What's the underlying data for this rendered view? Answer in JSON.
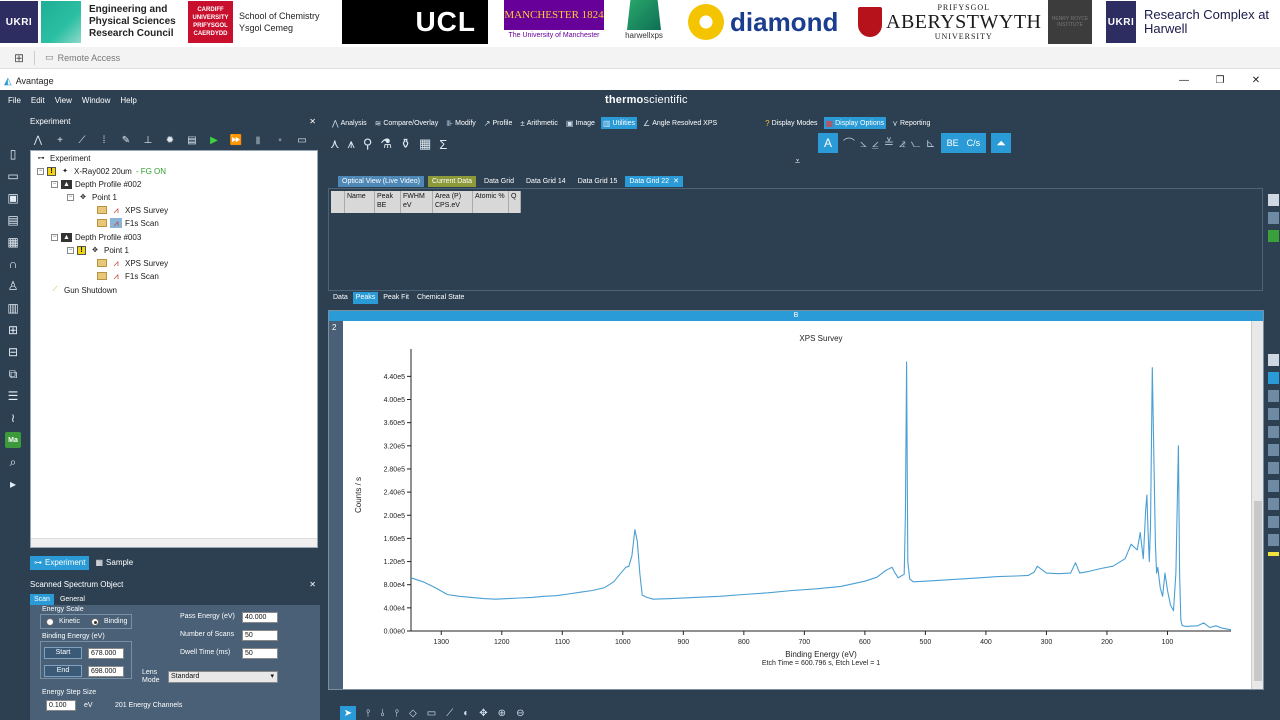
{
  "logos": {
    "ukri_1": "UKRI",
    "epsrc": "Engineering and Physical Sciences Research Council",
    "cardiff_mark": "CARDIFF UNIVERSITY PRIFYSGOL CAERDYDD",
    "cardiff_text": "School of Chemistry Ysgol Cemeg",
    "ucl": "UCL",
    "manchester": "MANCHESTER 1824",
    "manchester_sub": "The University of Manchester",
    "harwell": "harwellxps",
    "diamond": "diamond",
    "aber_top": "PRIFYSGOL",
    "aber_main": "ABERYSTWYTH",
    "aber_bottom": "UNIVERSITY",
    "hra": "HENRY ROYCE INSTITUTE",
    "rch": "Research Complex at Harwell"
  },
  "remote": {
    "label": "Remote Access"
  },
  "window": {
    "title": "Avantage",
    "minimize": "—",
    "maximize": "❐",
    "close": "✕"
  },
  "menu": [
    "File",
    "Edit",
    "View",
    "Window",
    "Help"
  ],
  "brand": {
    "bold": "thermo",
    "rest": "scientific"
  },
  "experiment": {
    "header": "Experiment",
    "close": "✕",
    "tree": {
      "root": "Experiment",
      "xray": "X-Ray002 20um",
      "fg": "- FG  ON",
      "dp2": "Depth Profile #002",
      "point1a": "Point 1",
      "xps1": "XPS Survey",
      "f1s1": "F1s Scan",
      "dp3": "Depth Profile #003",
      "point1b": "Point 1",
      "xps2": "XPS Survey",
      "f1s2": "F1s Scan",
      "gun": "Gun Shutdown"
    },
    "tabs": [
      "Experiment",
      "Sample"
    ]
  },
  "sso": {
    "header": "Scanned Spectrum Object",
    "close": "✕",
    "tabs": [
      "Scan",
      "General"
    ],
    "energy_scale": "Energy Scale",
    "kinetic": "Kinetic",
    "binding": "Binding",
    "binding_energy": "Binding Energy (eV)",
    "start_label": "Start",
    "start_value": "678.000",
    "end_label": "End",
    "end_value": "698.000",
    "pass_energy_label": "Pass Energy (eV)",
    "pass_energy_value": "40.000",
    "num_scans_label": "Number of Scans",
    "num_scans_value": "50",
    "dwell_label": "Dwell Time  (ms)",
    "dwell_value": "50",
    "lens_label": "Lens Mode",
    "lens_value": "Standard",
    "step_label": "Energy Step Size",
    "step_value": "0.100",
    "step_unit": "eV",
    "channels": "201 Energy Channels"
  },
  "ribbon": {
    "tabs": [
      "Analysis",
      "Compare/Overlay",
      "Modify",
      "Profile",
      "Arithmetic",
      "Image",
      "Utilities",
      "Angle Resolved XPS"
    ],
    "right_tabs": [
      "Display Modes",
      "Display Options",
      "Reporting"
    ],
    "pill_be": "BE",
    "pill_cs": "C/s"
  },
  "doc_tabs": [
    "Optical View (Live Video)",
    "Current Data",
    "Data Grid",
    "Data Grid 14",
    "Data Grid 15",
    "Data Grid 22"
  ],
  "grid": {
    "headers": [
      "",
      "Name",
      "Peak BE",
      "FWHM eV",
      "Area (P) CPS.eV",
      "Atomic %",
      "Q"
    ],
    "tabs": [
      "Data",
      "Peaks",
      "Peak Fit",
      "Chemical State"
    ]
  },
  "chart_panel": {
    "title": "B",
    "index": "2"
  },
  "chart_data": {
    "type": "line",
    "title": "XPS Survey",
    "xlabel": "Binding Energy (eV)",
    "ylabel": "Counts / s",
    "footer": "Etch Time = 600.796 s, Etch Level = 1",
    "xlim": [
      1350,
      -5
    ],
    "ylim": [
      0,
      470000
    ],
    "x_ticks": [
      1300,
      1200,
      1100,
      1000,
      900,
      800,
      700,
      600,
      500,
      400,
      300,
      200,
      100
    ],
    "y_ticks": [
      0,
      40000,
      80000,
      120000,
      160000,
      200000,
      240000,
      280000,
      320000,
      360000,
      400000,
      440000
    ],
    "y_tick_labels": [
      "0.00e0",
      "4.00e4",
      "8.00e4",
      "1.20e5",
      "1.60e5",
      "2.00e5",
      "2.40e5",
      "2.80e5",
      "3.20e5",
      "3.60e5",
      "4.00e5",
      "4.40e5"
    ],
    "grid": false,
    "series": [
      {
        "color": "#4a9fd4",
        "x": [
          1350,
          1330,
          1310,
          1290,
          1270,
          1250,
          1230,
          1210,
          1190,
          1170,
          1150,
          1130,
          1110,
          1090,
          1070,
          1050,
          1030,
          1015,
          1005,
          995,
          990,
          985,
          980,
          976,
          972,
          968,
          960,
          950,
          920,
          880,
          840,
          800,
          760,
          720,
          680,
          640,
          600,
          580,
          565,
          555,
          550,
          545,
          540,
          535,
          533,
          531,
          529,
          526,
          520,
          500,
          470,
          440,
          410,
          380,
          350,
          330,
          320,
          315,
          300,
          280,
          260,
          252,
          245,
          230,
          210,
          190,
          170,
          160,
          150,
          145,
          140,
          136,
          134,
          132,
          130,
          128,
          125,
          120,
          118,
          116,
          112,
          108,
          104,
          100,
          95,
          90,
          86,
          82,
          80,
          78,
          76,
          74,
          70,
          60,
          50,
          40,
          30,
          20,
          10,
          -5
        ],
        "y": [
          92000,
          85000,
          75000,
          63000,
          60000,
          58000,
          56000,
          55000,
          56000,
          57000,
          58000,
          60000,
          61000,
          64000,
          67000,
          70000,
          75000,
          85000,
          98000,
          110000,
          112000,
          130000,
          175000,
          155000,
          100000,
          62000,
          58000,
          55000,
          56000,
          58000,
          60000,
          63000,
          66000,
          70000,
          73000,
          77000,
          86000,
          93000,
          105000,
          110000,
          100000,
          92000,
          95000,
          98000,
          200000,
          465000,
          120000,
          90000,
          85000,
          86000,
          88000,
          90000,
          92000,
          94000,
          95000,
          96000,
          102000,
          112000,
          100000,
          99000,
          100000,
          118000,
          100000,
          103000,
          108000,
          112000,
          125000,
          150000,
          140000,
          170000,
          125000,
          210000,
          235000,
          170000,
          120000,
          180000,
          455000,
          150000,
          100000,
          110000,
          75000,
          60000,
          100000,
          70000,
          45000,
          35000,
          100000,
          320000,
          100000,
          20000,
          10000,
          9000,
          8000,
          8500,
          9000,
          14000,
          6000,
          9000,
          5000,
          2000
        ]
      }
    ]
  },
  "colors": {
    "accent": "#2a9bd6",
    "app_bg": "#2d4052",
    "panel": "#4a6076",
    "trace": "#4a9fd4"
  }
}
